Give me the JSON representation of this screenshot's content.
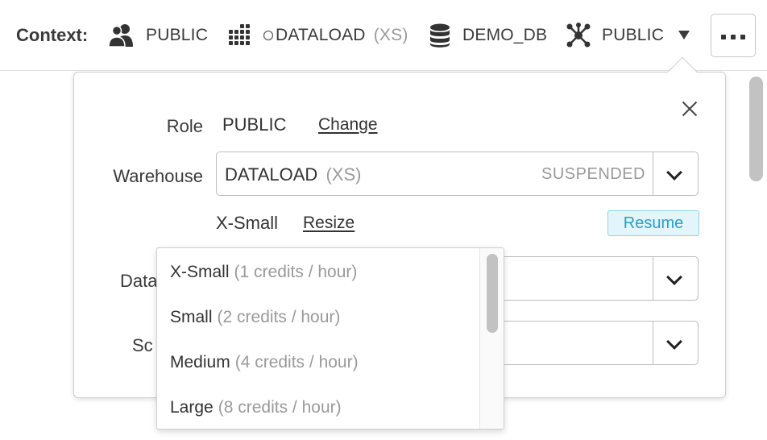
{
  "context_bar": {
    "label": "Context:",
    "role": "PUBLIC",
    "warehouse_name": "DATALOAD",
    "warehouse_size": "(XS)",
    "database": "DEMO_DB",
    "schema": "PUBLIC"
  },
  "popover": {
    "role_label": "Role",
    "role_value": "PUBLIC",
    "change_link": "Change",
    "warehouse_label": "Warehouse",
    "warehouse_name": "DATALOAD",
    "warehouse_size": "(XS)",
    "warehouse_status": "SUSPENDED",
    "size_value": "X-Small",
    "resize_link": "Resize",
    "resume_button": "Resume",
    "database_label_partial": "Data",
    "schema_label_partial": "Sc"
  },
  "size_dropdown": {
    "options": [
      {
        "name": "X-Small",
        "credits": "(1 credits / hour)"
      },
      {
        "name": "Small",
        "credits": "(2 credits / hour)"
      },
      {
        "name": "Medium",
        "credits": "(4 credits / hour)"
      },
      {
        "name": "Large",
        "credits": "(8 credits / hour)"
      }
    ]
  },
  "colors": {
    "resume_bg": "#e3f5fb",
    "resume_text": "#2b9ec4",
    "muted_text": "#9a9a9a"
  }
}
